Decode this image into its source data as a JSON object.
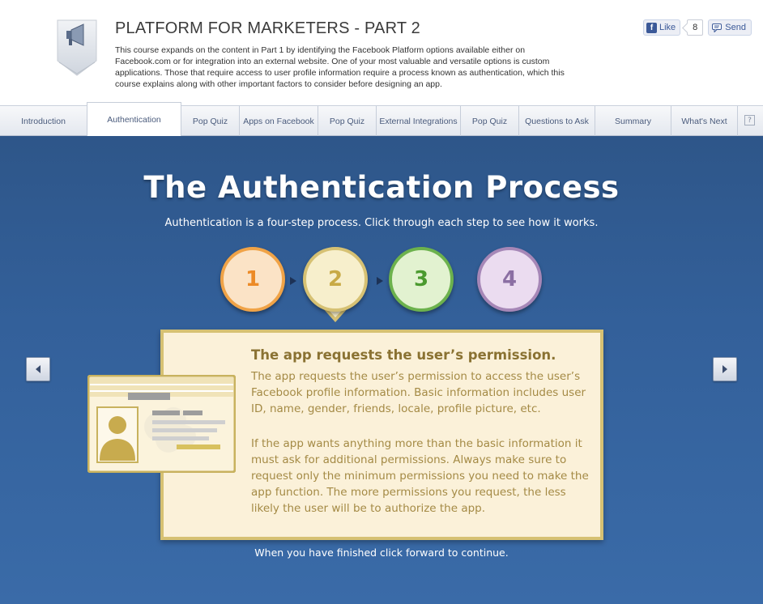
{
  "header": {
    "icon": "megaphone-icon",
    "title": "PLATFORM FOR MARKETERS - PART 2",
    "description": "This course expands on the content in Part 1 by identifying the Facebook Platform options available either on Facebook.com or for integration into an external website. One of your most valuable and versatile options is custom applications. Those that require access to user profile information require a process known as authentication, which this course explains along with other important factors to consider before designing an app.",
    "social": {
      "like_label": "Like",
      "like_count": "8",
      "send_label": "Send"
    }
  },
  "tabs": [
    {
      "label": "Introduction"
    },
    {
      "label": "Authentication",
      "active": true
    },
    {
      "label": "Pop Quiz"
    },
    {
      "label": "Apps on Facebook"
    },
    {
      "label": "Pop Quiz"
    },
    {
      "label": "External Integrations"
    },
    {
      "label": "Pop Quiz"
    },
    {
      "label": "Questions to Ask"
    },
    {
      "label": "Summary"
    },
    {
      "label": "What's Next"
    }
  ],
  "help_label": "?",
  "stage": {
    "title": "The Authentication Process",
    "subtitle": "Authentication is a four-step process. Click through each step to see how it works.",
    "steps": [
      {
        "number": "1",
        "color": "#f0a347"
      },
      {
        "number": "2",
        "color": "#d6c173",
        "selected": true
      },
      {
        "number": "3",
        "color": "#6cb24d"
      },
      {
        "number": "4",
        "color": "#a687b7"
      }
    ],
    "card": {
      "heading": "The app requests the user’s permission.",
      "paragraph_1": "The app requests the user’s permission to access the user’s Facebook profile information. Basic information includes user ID, name, gender, friends, locale, profile picture, etc.",
      "paragraph_2": "If the app wants anything more than the basic information it must ask for additional permissions. Always make sure to request only the minimum permissions you need to make the app function. The more permissions you request, the less likely the user will be to authorize the app."
    },
    "footer": "When you have finished click forward to continue."
  },
  "colors": {
    "stage_bg": "#33609a",
    "card_bg": "#fbf1d9",
    "card_border": "#d6c173",
    "card_text": "#a48a45",
    "heading_text": "#8a7232"
  }
}
